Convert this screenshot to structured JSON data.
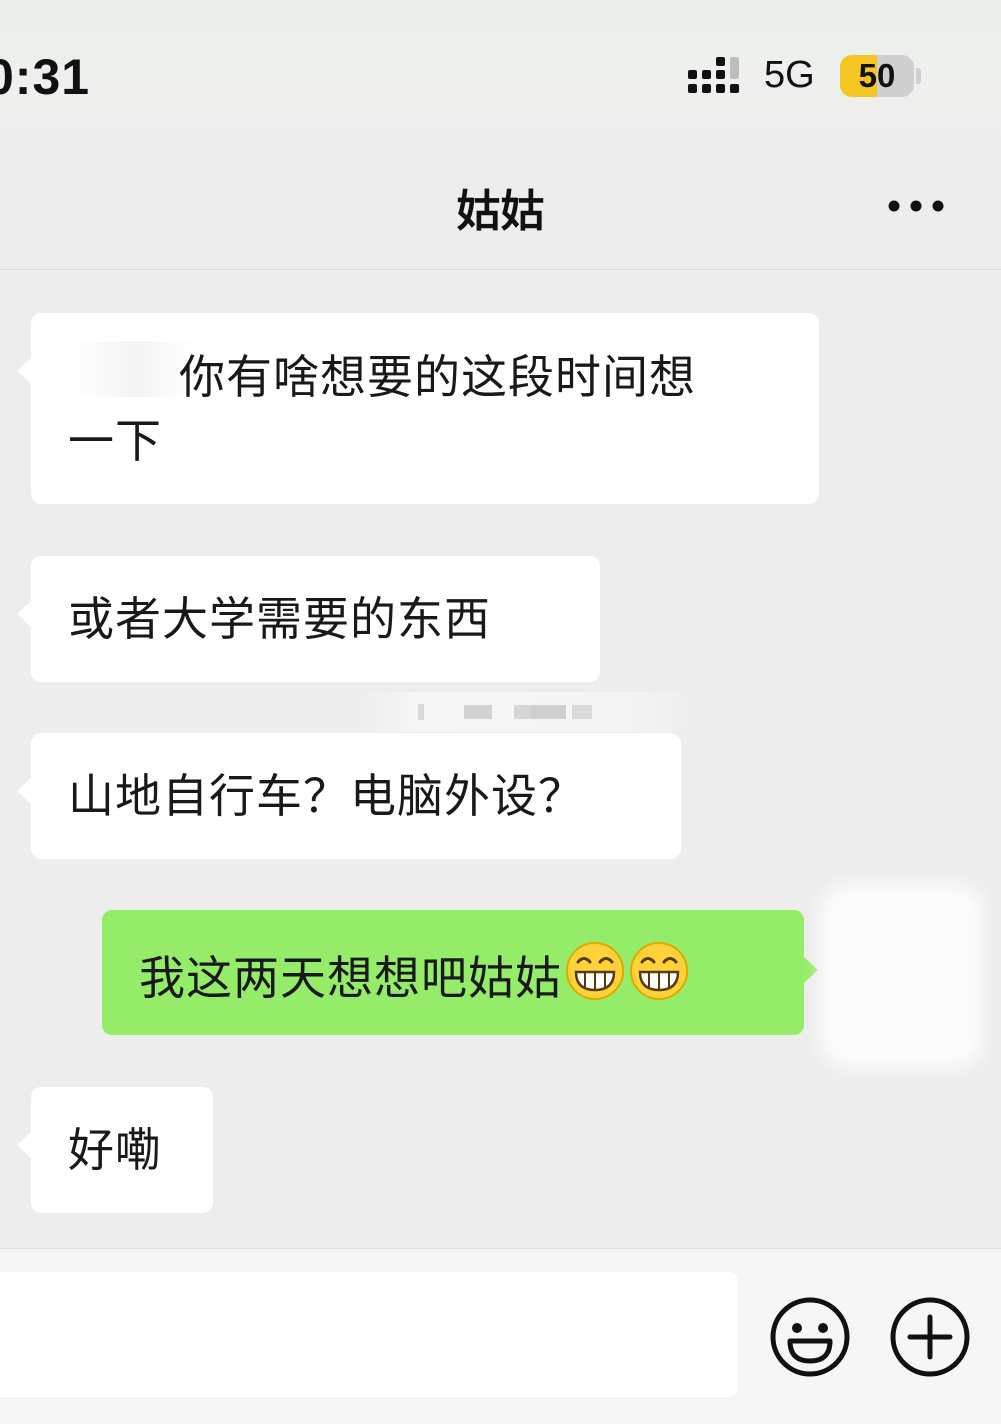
{
  "status_bar": {
    "time": "0:31",
    "network": "5G",
    "battery_level": "50",
    "battery_fraction": 0.5,
    "battery_color": "#f5c623"
  },
  "nav": {
    "title": "姑姑",
    "more_icon": "more-dots-icon"
  },
  "messages": [
    {
      "side": "incoming",
      "lines": [
        "你有啥想要的这段时间想",
        "一下"
      ]
    },
    {
      "side": "incoming",
      "text": "或者大学需要的东西"
    },
    {
      "side": "incoming",
      "text": "山地自行车？电脑外设？"
    },
    {
      "side": "outgoing",
      "text": "我这两天想想吧姑姑",
      "emojis": [
        "grin-emoji",
        "grin-emoji"
      ]
    },
    {
      "side": "incoming",
      "text": "好嘞"
    }
  ],
  "input_bar": {
    "emoji_icon": "smiley-icon",
    "plus_icon": "plus-circle-icon"
  },
  "colors": {
    "background": "#ededed",
    "incoming_bubble": "#ffffff",
    "outgoing_bubble": "#95ec69"
  }
}
